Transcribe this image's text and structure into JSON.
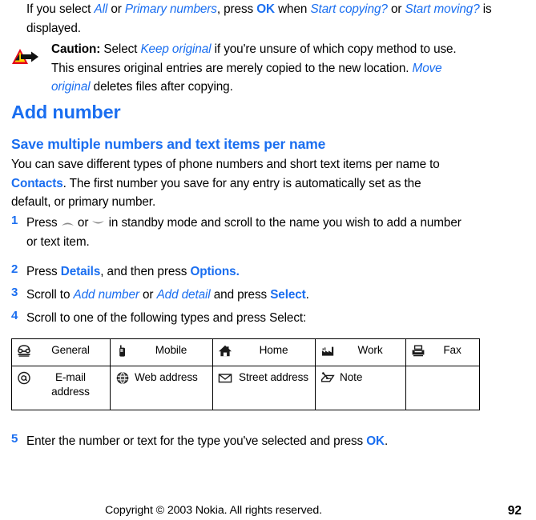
{
  "intro": {
    "seg1": "If you select ",
    "all": "All",
    "seg2": " or ",
    "primary_numbers": "Primary numbers",
    "seg3": ", press ",
    "ok": "OK",
    "seg4": " when ",
    "start_copying": "Start copying?",
    "seg5": " or ",
    "start_moving": "Start moving?",
    "seg6": " is displayed."
  },
  "caution": {
    "icon": "caution-triangle-arrow-icon",
    "label": "Caution:",
    "seg1": " Select ",
    "keep_original": "Keep original",
    "seg2": " if you're unsure of which copy method to use. This ensures original entries are merely copied to the new location. ",
    "move_original": "Move original",
    "seg3": " deletes files after copying."
  },
  "headings": {
    "h1": "Add number",
    "h2": "Save multiple numbers and text items per name"
  },
  "h2_paragraph": {
    "seg1": "You can save different types of phone numbers and short text items per name to ",
    "contacts": "Contacts",
    "seg2": ". The first number you save for any entry is automatically set as the default, or primary number."
  },
  "steps": [
    {
      "num": "1",
      "seg1": "Press ",
      "up_arrow_icon": "scroll-up-arrow-icon",
      "seg2": " or ",
      "down_arrow_icon": "scroll-down-arrow-icon",
      "seg3": " in standby mode and scroll to the name you wish to add a number or text item."
    },
    {
      "num": "2",
      "seg1": "Press ",
      "details": "Details",
      "seg2": ", and then press ",
      "options": "Options.",
      "seg3": ""
    },
    {
      "num": "3",
      "seg1": "Scroll to ",
      "add_number": "Add number",
      "seg2": " or ",
      "add_detail": "Add detail",
      "seg3": " and press ",
      "select": "Select",
      "seg4": "."
    },
    {
      "num": "4",
      "seg1": "Scroll to one of the following types and press Select:"
    },
    {
      "num": "5",
      "seg1": "Enter the number or text for the type you've selected and press ",
      "ok": "OK",
      "seg2": "."
    }
  ],
  "types_table": {
    "rows": [
      [
        {
          "icon": "telephone-icon",
          "label": "General"
        },
        {
          "icon": "mobile-phone-icon",
          "label": "Mobile"
        },
        {
          "icon": "house-icon",
          "label": "Home"
        },
        {
          "icon": "factory-icon",
          "label": "Work"
        },
        {
          "icon": "fax-machine-icon",
          "label": "Fax"
        }
      ],
      [
        {
          "icon": "at-sign-icon",
          "label": "E-mail address"
        },
        {
          "icon": "globe-icon",
          "label": "Web address"
        },
        {
          "icon": "envelope-icon",
          "label": "Street address"
        },
        {
          "icon": "note-pen-icon",
          "label": "Note"
        },
        {
          "icon": "",
          "label": ""
        }
      ]
    ]
  },
  "footer": {
    "copyright": "Copyright © 2003 Nokia. All rights reserved.",
    "page_number": "92"
  },
  "colors": {
    "accent_blue": "#1a6ef0",
    "text_black": "#000000",
    "caution_yellow": "#ffd500",
    "caution_red": "#e3051b"
  }
}
